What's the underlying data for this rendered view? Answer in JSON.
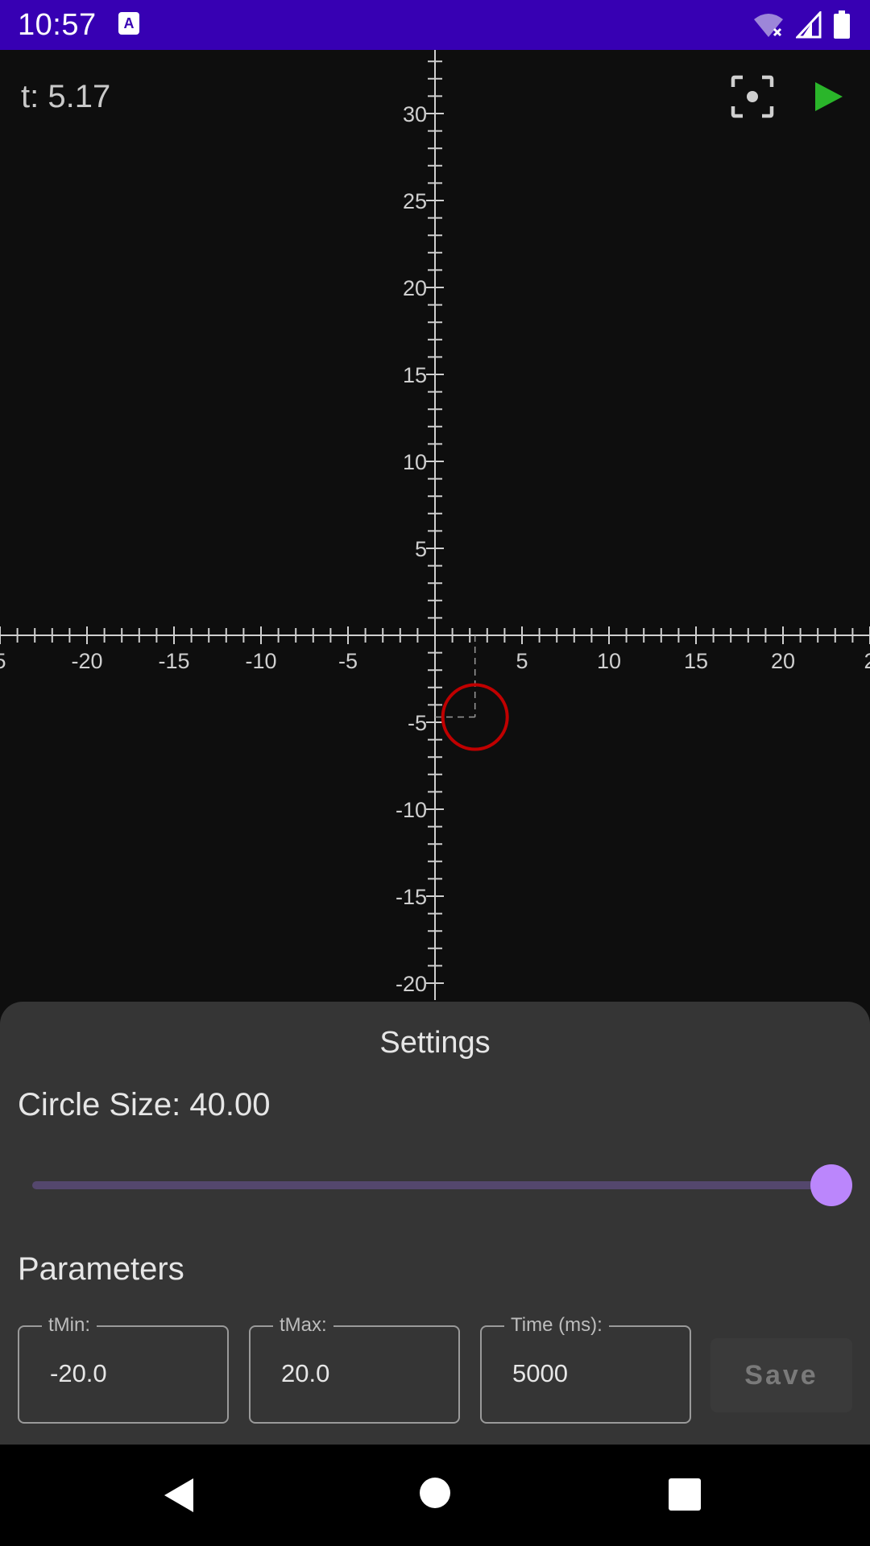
{
  "status_bar": {
    "time": "10:57",
    "icons": [
      "keyboard-notification-icon",
      "wifi-off-icon",
      "signal-icon",
      "battery-icon"
    ],
    "background": "#3700b3"
  },
  "plot": {
    "t_label": "t: 5.17",
    "x_tick_labels": [
      "5",
      "-20",
      "-15",
      "-10",
      "-5",
      "5",
      "10",
      "15",
      "20",
      "2"
    ],
    "y_tick_labels": [
      "30",
      "25",
      "20",
      "15",
      "10",
      "5",
      "-5",
      "-10",
      "-15",
      "-20"
    ],
    "circle": {
      "x": 2.3,
      "y": -4.7,
      "stroke": "#c00000"
    },
    "axis_color": "#cfcfcf",
    "toolbar": {
      "focus_icon": "center-focus-icon",
      "play_icon": "play-icon",
      "play_color": "#2ab52a"
    }
  },
  "settings": {
    "title": "Settings",
    "circle_size_label": "Circle Size: 40.00",
    "slider": {
      "value": 40,
      "fraction": 1.0,
      "accent": "#bb86fc"
    },
    "parameters_title": "Parameters",
    "fields": [
      {
        "label": "tMin:",
        "value": "-20.0"
      },
      {
        "label": "tMax:",
        "value": "20.0"
      },
      {
        "label": "Time (ms):",
        "value": "5000"
      }
    ],
    "save_label": "Save"
  },
  "nav_bar": {
    "icons": [
      "back-icon",
      "home-icon",
      "recents-icon"
    ]
  }
}
